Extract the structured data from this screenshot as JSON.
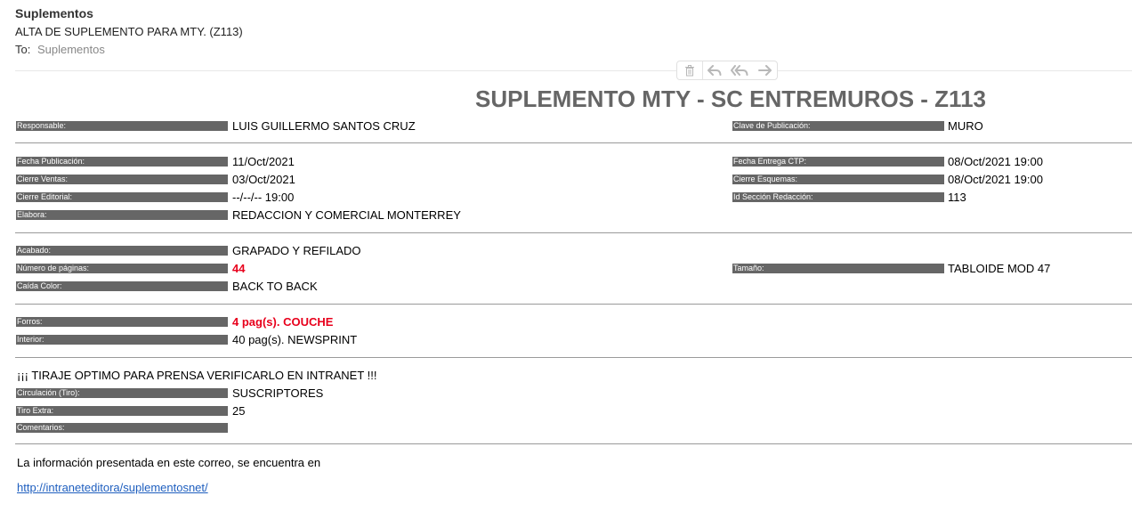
{
  "header": {
    "sender": "Suplementos",
    "subject": "ALTA DE SUPLEMENTO PARA MTY. (Z113)",
    "to_label": "To:",
    "to_value": "Suplementos"
  },
  "toolbar": {
    "icons": [
      "trash-icon",
      "reply-icon",
      "reply-all-icon",
      "forward-icon"
    ]
  },
  "doc": {
    "title": "SUPLEMENTO MTY - SC ENTREMUROS - Z113"
  },
  "fields": {
    "responsable": {
      "label": "Responsable:",
      "value": "LUIS GUILLERMO SANTOS CRUZ"
    },
    "clave": {
      "label": "Clave de Publicación:",
      "value": "MURO"
    },
    "fecha_pub": {
      "label": "Fecha Publicación:",
      "value": "11/Oct/2021"
    },
    "fecha_ctp": {
      "label": "Fecha Entrega CTP:",
      "value": "08/Oct/2021 19:00"
    },
    "cierre_ventas": {
      "label": "Cierre Ventas:",
      "value": "03/Oct/2021"
    },
    "cierre_esquemas": {
      "label": "Cierre Esquemas:",
      "value": "08/Oct/2021 19:00"
    },
    "cierre_editorial": {
      "label": "Cierre Editorial:",
      "value": "--/--/-- 19:00"
    },
    "id_seccion": {
      "label": "Id Sección Redacción:",
      "value": "113"
    },
    "elabora": {
      "label": "Elabora:",
      "value": "REDACCION Y COMERCIAL MONTERREY"
    },
    "acabado": {
      "label": "Acabado:",
      "value": "GRAPADO Y REFILADO"
    },
    "num_paginas": {
      "label": "Número de páginas:",
      "value": "44"
    },
    "tamano": {
      "label": "Tamaño:",
      "value": "TABLOIDE MOD 47"
    },
    "caida_color": {
      "label": "Caída Color:",
      "value": "BACK TO BACK"
    },
    "forros": {
      "label": "Forros:",
      "value": "4 pag(s). COUCHE"
    },
    "interior": {
      "label": "Interior:",
      "value": "40 pag(s). NEWSPRINT"
    },
    "circulacion": {
      "label": "Circulación (Tiro):",
      "value": "SUSCRIPTORES"
    },
    "tiro_extra": {
      "label": "Tiro Extra:",
      "value": "25"
    },
    "comentarios": {
      "label": "Comentarios:",
      "value": ""
    }
  },
  "notice": "¡¡¡ TIRAJE OPTIMO PARA PRENSA VERIFICARLO EN INTRANET !!!",
  "footer": {
    "text": "La información presentada en este correo, se encuentra en",
    "link": "http://intraneteditora/suplementosnet/"
  },
  "colors": {
    "label_bg": "#666666",
    "highlight_red": "#e8001c",
    "link_blue": "#1f5fbf"
  }
}
